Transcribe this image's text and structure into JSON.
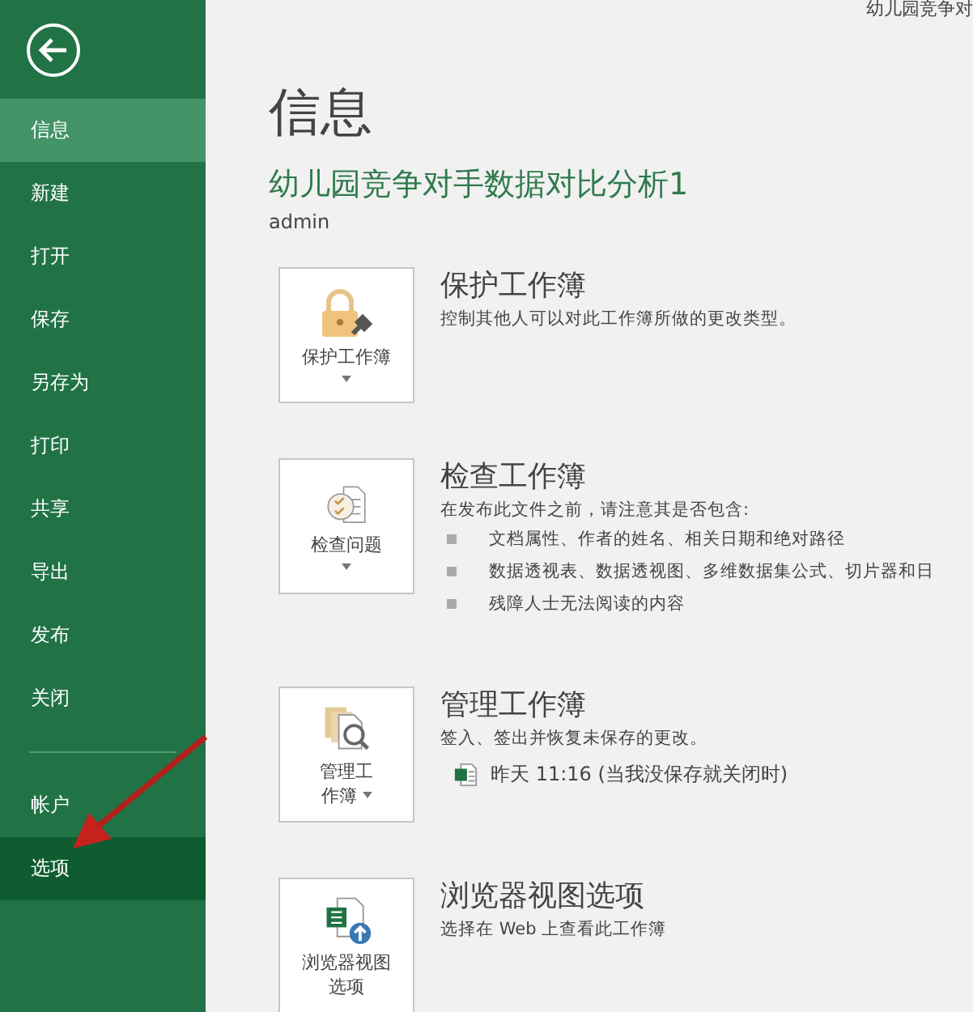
{
  "window": {
    "title": "幼儿园竞争对"
  },
  "sidebar": {
    "items": [
      {
        "label": "信息",
        "selected": true,
        "hovered": false
      },
      {
        "label": "新建",
        "selected": false,
        "hovered": false
      },
      {
        "label": "打开",
        "selected": false,
        "hovered": false
      },
      {
        "label": "保存",
        "selected": false,
        "hovered": false
      },
      {
        "label": "另存为",
        "selected": false,
        "hovered": false
      },
      {
        "label": "打印",
        "selected": false,
        "hovered": false
      },
      {
        "label": "共享",
        "selected": false,
        "hovered": false
      },
      {
        "label": "导出",
        "selected": false,
        "hovered": false
      },
      {
        "label": "发布",
        "selected": false,
        "hovered": false
      },
      {
        "label": "关闭",
        "selected": false,
        "hovered": false
      }
    ],
    "bottom_items": [
      {
        "label": "帐户",
        "selected": false,
        "hovered": false
      },
      {
        "label": "选项",
        "selected": false,
        "hovered": true
      }
    ]
  },
  "page": {
    "title": "信息",
    "file_name": "幼儿园竞争对手数据对比分析1",
    "author": "admin"
  },
  "sections": [
    {
      "kind": "protect",
      "button": {
        "lines": [
          "保护工作簿"
        ],
        "dropdown": true
      },
      "title": "保护工作簿",
      "description": "控制其他人可以对此工作簿所做的更改类型。"
    },
    {
      "kind": "inspect",
      "button": {
        "lines": [
          "检查问题"
        ],
        "dropdown": true
      },
      "title": "检查工作簿",
      "description": "在发布此文件之前，请注意其是否包含:",
      "bullets": [
        "文档属性、作者的姓名、相关日期和绝对路径",
        "数据透视表、数据透视图、多维数据集公式、切片器和日",
        "残障人士无法阅读的内容"
      ]
    },
    {
      "kind": "manage",
      "button": {
        "lines": [
          "管理工",
          "作簿"
        ],
        "dropdown": true
      },
      "title": "管理工作簿",
      "description": "签入、签出并恢复未保存的更改。",
      "versions": [
        "昨天 11:16 (当我没保存就关闭时)"
      ]
    },
    {
      "kind": "browser",
      "button": {
        "lines": [
          "浏览器视图",
          "选项"
        ],
        "dropdown": false
      },
      "title": "浏览器视图选项",
      "description": "选择在 Web 上查看此工作簿"
    }
  ]
}
